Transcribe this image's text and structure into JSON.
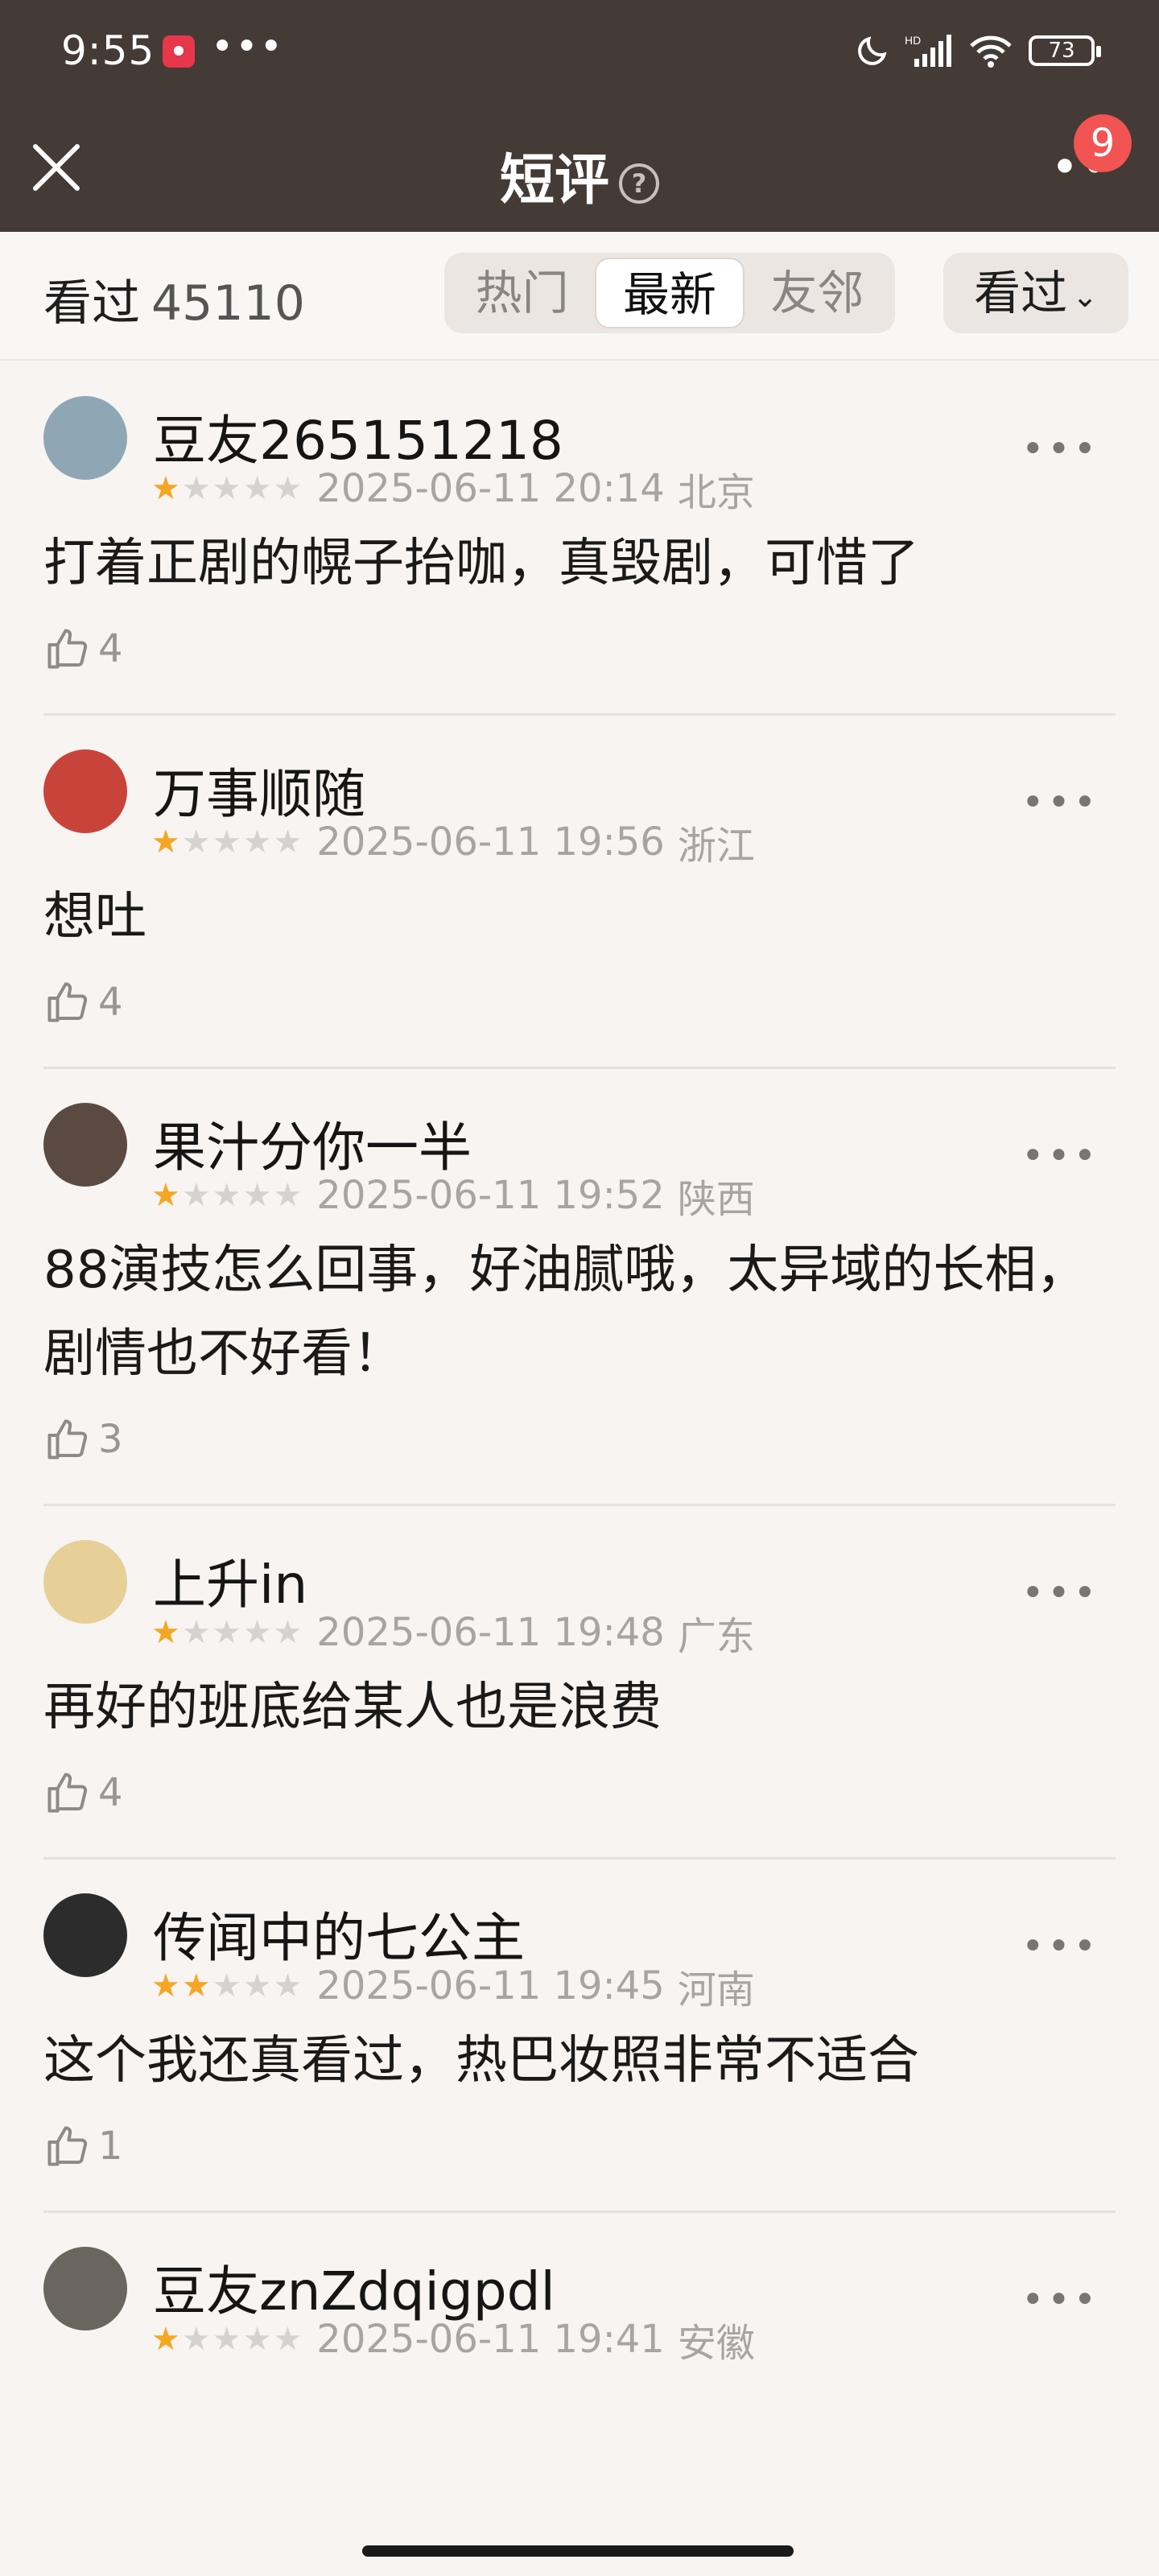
{
  "status_bar": {
    "time": "9:55",
    "dots": "•••",
    "battery": "73"
  },
  "header": {
    "title": "短评",
    "help_mark": "?",
    "badge": "9"
  },
  "filter": {
    "seen_label": "看过",
    "seen_count": "45110",
    "tabs": [
      "热门",
      "最新",
      "友邻"
    ],
    "active_tab": "最新",
    "sort_label": "看过"
  },
  "comments": [
    {
      "user": "豆友265151218",
      "stars": 1,
      "datetime": "2025-06-11 20:14",
      "location": "北京",
      "text": "打着正剧的幌子抬咖，真毁剧，可惜了",
      "likes": "4",
      "avatar_color": "#8fa6b5"
    },
    {
      "user": "万事顺随",
      "stars": 1,
      "datetime": "2025-06-11 19:56",
      "location": "浙江",
      "text": "想吐",
      "likes": "4",
      "avatar_color": "#c8443a"
    },
    {
      "user": "果汁分你一半",
      "stars": 1,
      "datetime": "2025-06-11 19:52",
      "location": "陕西",
      "text": "88演技怎么回事，好油腻哦，太异域的长相，剧情也不好看！",
      "likes": "3",
      "avatar_color": "#5b4a42"
    },
    {
      "user": "上升in",
      "stars": 1,
      "datetime": "2025-06-11 19:48",
      "location": "广东",
      "text": "再好的班底给某人也是浪费",
      "likes": "4",
      "avatar_color": "#e7cf98"
    },
    {
      "user": "传闻中的七公主",
      "stars": 2,
      "datetime": "2025-06-11 19:45",
      "location": "河南",
      "text": "这个我还真看过，热巴妆照非常不适合",
      "likes": "1",
      "avatar_color": "#2c2c2c"
    },
    {
      "user": "豆友znZdqigpdl",
      "stars": 1,
      "datetime": "2025-06-11 19:41",
      "location": "安徽",
      "text": "",
      "likes": "",
      "avatar_color": "#6b655f"
    }
  ]
}
